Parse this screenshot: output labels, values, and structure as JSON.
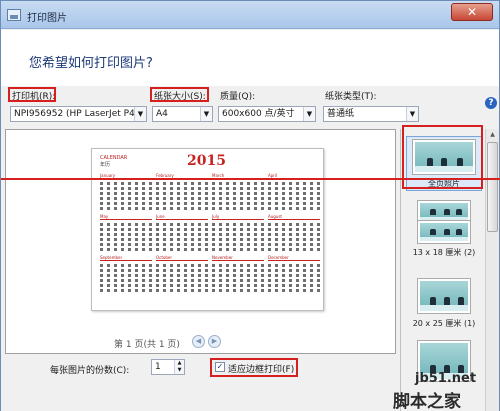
{
  "window": {
    "title": "打印图片",
    "close_glyph": "✕"
  },
  "heading": "您希望如何打印图片?",
  "toolbar": {
    "printer_label": "打印机(R):",
    "printer_value": "NPI956952 (HP LaserJet P4015",
    "paper_size_label": "纸张大小(S):",
    "paper_size_value": "A4",
    "quality_label": "质量(Q):",
    "quality_value": "600x600 点/英寸",
    "paper_type_label": "纸张类型(T):",
    "paper_type_value": "普通纸",
    "help_glyph": "?"
  },
  "preview": {
    "calendar_head": "CALENDAR",
    "calendar_sub": "年历",
    "year": "2015",
    "months": [
      "January",
      "February",
      "March",
      "April",
      "May",
      "June",
      "July",
      "August",
      "September",
      "October",
      "November",
      "December"
    ],
    "page_indicator": "第 1 页(共 1 页)"
  },
  "layouts": [
    {
      "label": "全页照片"
    },
    {
      "label": "13 x 18 厘米 (2)"
    },
    {
      "label": "20 x 25 厘米 (1)"
    }
  ],
  "bottom": {
    "copies_label": "每张图片的份数(C):",
    "copies_value": "1",
    "fit_label": "适应边框打印(F)",
    "fit_checked": "✓"
  },
  "watermark": {
    "site": "jb51.net",
    "name": "脚本之家"
  }
}
